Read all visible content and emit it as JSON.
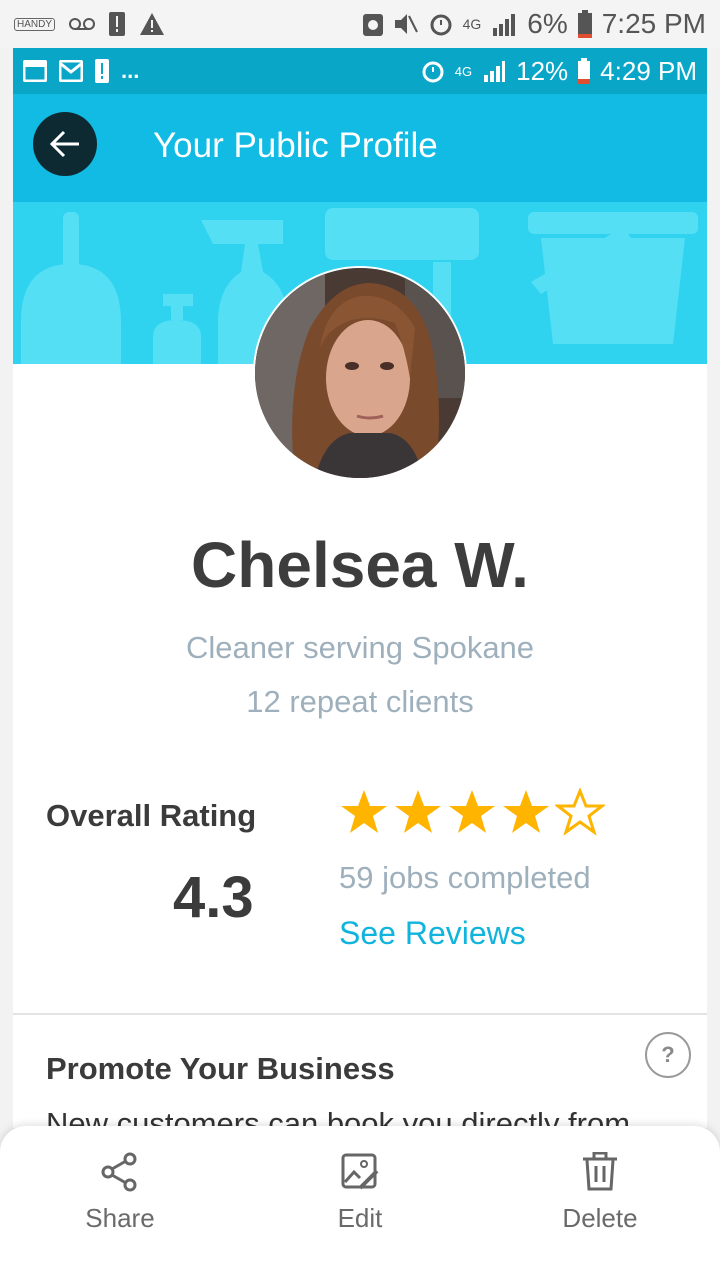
{
  "outer_status": {
    "app_label": "HANDY",
    "battery": "6%",
    "time": "7:25 PM",
    "network": "4G"
  },
  "inner_status": {
    "battery": "12%",
    "time": "4:29 PM",
    "network": "4G",
    "more": "..."
  },
  "header": {
    "title": "Your Public Profile"
  },
  "profile": {
    "name": "Chelsea W.",
    "subtitle": "Cleaner serving Spokane",
    "repeat_clients": "12 repeat clients"
  },
  "rating": {
    "label": "Overall Rating",
    "value": "4.3",
    "stars_filled": 4,
    "stars_total": 5,
    "jobs_completed": "59 jobs completed",
    "see_reviews": "See Reviews"
  },
  "promote": {
    "title": "Promote Your Business",
    "text": "New customers can book you directly from",
    "help": "?"
  },
  "sheet": {
    "share": "Share",
    "edit": "Edit",
    "delete": "Delete"
  },
  "colors": {
    "header": "#12bbe3",
    "banner": "#2fd3f0",
    "link": "#11b4dc",
    "star": "#ffb400"
  }
}
